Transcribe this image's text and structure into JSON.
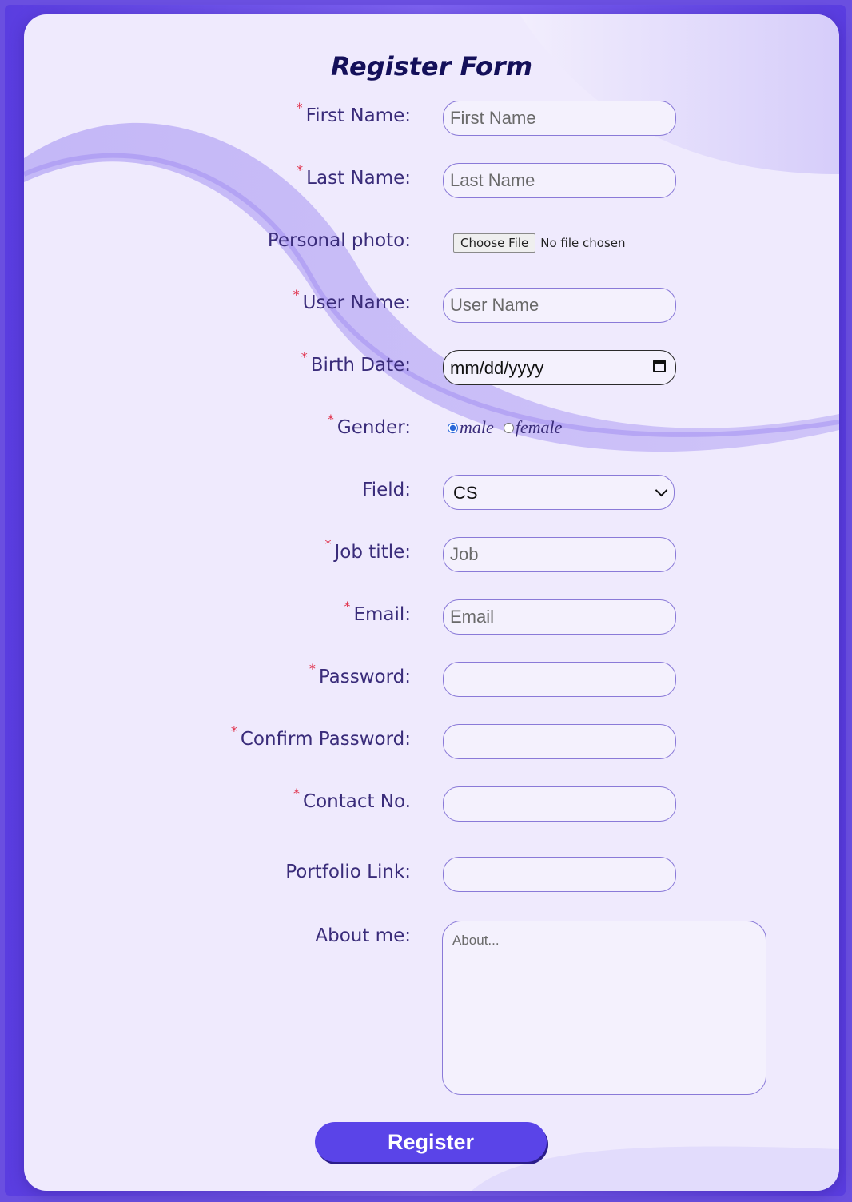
{
  "form": {
    "title": "Register Form",
    "first_name": {
      "label": "First Name:",
      "required": true,
      "placeholder": "First Name"
    },
    "last_name": {
      "label": "Last Name:",
      "required": true,
      "placeholder": "Last Name"
    },
    "photo": {
      "label": "Personal photo:",
      "button": "Choose File",
      "status": "No file chosen"
    },
    "user_name": {
      "label": "User Name:",
      "required": true,
      "placeholder": "User Name"
    },
    "birth_date": {
      "label": "Birth Date:",
      "required": true,
      "value": "mm/dd/yyyy"
    },
    "gender": {
      "label": "Gender:",
      "required": true,
      "options": [
        "male",
        "female"
      ],
      "selected": "male"
    },
    "field": {
      "label": "Field:",
      "value": "CS"
    },
    "job_title": {
      "label": "Job title:",
      "required": true,
      "placeholder": "Job"
    },
    "email": {
      "label": "Email:",
      "required": true,
      "placeholder": "Email"
    },
    "password": {
      "label": "Password:",
      "required": true
    },
    "confirm_password": {
      "label": "Confirm Password:",
      "required": true
    },
    "contact": {
      "label": "Contact No.",
      "required": true
    },
    "portfolio": {
      "label": "Portfolio Link:"
    },
    "about": {
      "label": "About me:",
      "placeholder": "About..."
    },
    "submit_label": "Register",
    "required_mark": "*"
  },
  "colors": {
    "accent": "#5a44e8",
    "title": "#14105a",
    "label": "#3a2c7a",
    "required": "#e0304a"
  }
}
